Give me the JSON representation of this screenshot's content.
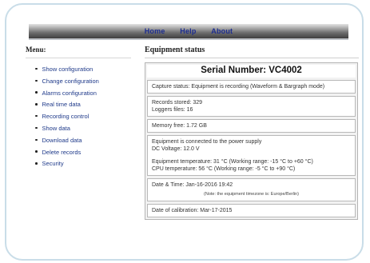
{
  "nav": {
    "items": [
      "Home",
      "Help",
      "About"
    ]
  },
  "menu": {
    "title": "Menu:",
    "items": [
      "Show configuration",
      "Change configuration",
      "Alarms configuration",
      "Real time data",
      "Recording control",
      "Show data",
      "Download data",
      "Delete records",
      "Security"
    ]
  },
  "main": {
    "title": "Equipment status",
    "serial": "Serial Number: VC4002",
    "capture_status": "Capture status: Equipment is recording (Waveform & Bargraph mode)",
    "records_stored": "Records stored: 329",
    "loggers_files": "Loggers files: 16",
    "memory_free": "Memory free: 1.72 GB",
    "power": "Equipment is connected to the power supply",
    "dc_voltage": "DC Voltage: 12.0 V",
    "equipment_temperature": "Equipment temperature: 31 °C (Working range: -15 °C to +60 °C)",
    "cpu_temperature": "CPU temperature: 56 °C (Working range: -5 °C to +90 °C)",
    "date_time": "Date & Time: Jan-16-2016 19:42",
    "timezone_note": "(Note: the equipment timezone is: Europe/Berlin)",
    "calibration_date": "Date of calibration: Mar-17-2015"
  },
  "colors": {
    "link": "#1f3a8a",
    "nav_text": "#1d2d8f",
    "frame_border": "#c9dde8"
  }
}
